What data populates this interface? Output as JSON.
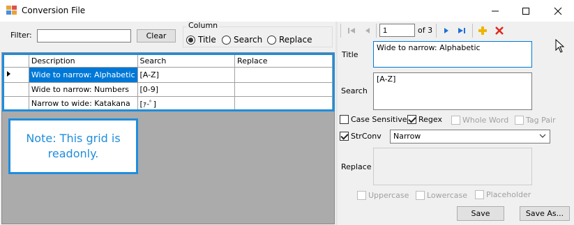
{
  "window": {
    "title": "Conversion File"
  },
  "filter": {
    "label": "Filter:",
    "value": "",
    "clear_label": "Clear"
  },
  "column": {
    "legend": "Column",
    "options": [
      "Title",
      "Search",
      "Replace"
    ],
    "selected": "Title"
  },
  "grid": {
    "columns": [
      "Description",
      "Search",
      "Replace"
    ],
    "rows": [
      {
        "description": "Wide to narrow: Alphabetic",
        "search": "[A-Z]",
        "replace": ""
      },
      {
        "description": "Wide to narrow: Numbers",
        "search": "[0-9]",
        "replace": ""
      },
      {
        "description": "Narrow to wide: Katakana",
        "search": "[ｧ-ﾟ]",
        "replace": ""
      }
    ],
    "note": "Note: This grid is readonly."
  },
  "navigator": {
    "position": "1",
    "of_label": "of 3"
  },
  "detail": {
    "title_label": "Title",
    "title_value": "Wide to narrow: Alphabetic",
    "search_label": "Search",
    "search_value": "[A-Z]",
    "options": {
      "case_sensitive": "Case Sensitive",
      "regex": "Regex",
      "whole_word": "Whole Word",
      "tag_pair": "Tag Pair",
      "strconv": "StrConv"
    },
    "strconv_value": "Narrow",
    "replace_label": "Replace",
    "uppercase": "Uppercase",
    "lowercase": "Lowercase",
    "placeholder": "Placeholder",
    "save_label": "Save",
    "save_as_label": "Save As..."
  },
  "colors": {
    "accent": "#1e8ddd",
    "selection": "#0078d7"
  }
}
